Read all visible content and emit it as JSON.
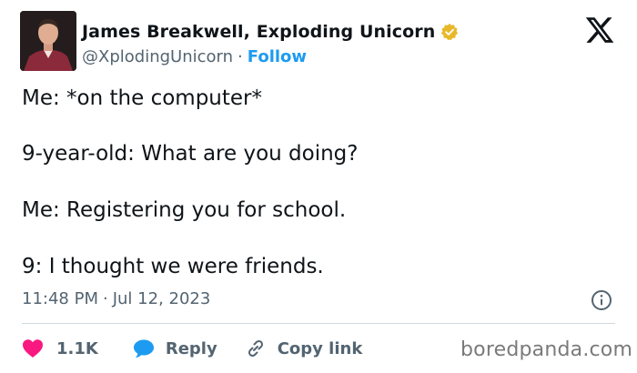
{
  "author": {
    "name": "James Breakwell, Exploding Unicorn",
    "handle": "@XplodingUnicorn",
    "separator": "·",
    "follow_label": "Follow",
    "verified_color": "#e8b829"
  },
  "tweet": {
    "lines": [
      "Me: *on the computer*",
      "9-year-old: What are you doing?",
      "Me: Registering you for school.",
      "9: I thought we were friends."
    ],
    "time": "11:48 PM",
    "separator": "·",
    "date": "Jul 12, 2023"
  },
  "actions": {
    "likes_count": "1.1K",
    "reply_label": "Reply",
    "copy_link_label": "Copy link"
  },
  "icons": {
    "platform": "x-logo-icon",
    "like": "heart-icon",
    "reply": "speech-bubble-icon",
    "copy": "link-icon",
    "info": "info-icon",
    "verified": "verified-badge-icon"
  },
  "colors": {
    "like": "#f91880",
    "reply": "#1d9bf0",
    "follow": "#1d9bf0",
    "secondary_text": "#536471"
  },
  "watermark": "boredpanda.com"
}
